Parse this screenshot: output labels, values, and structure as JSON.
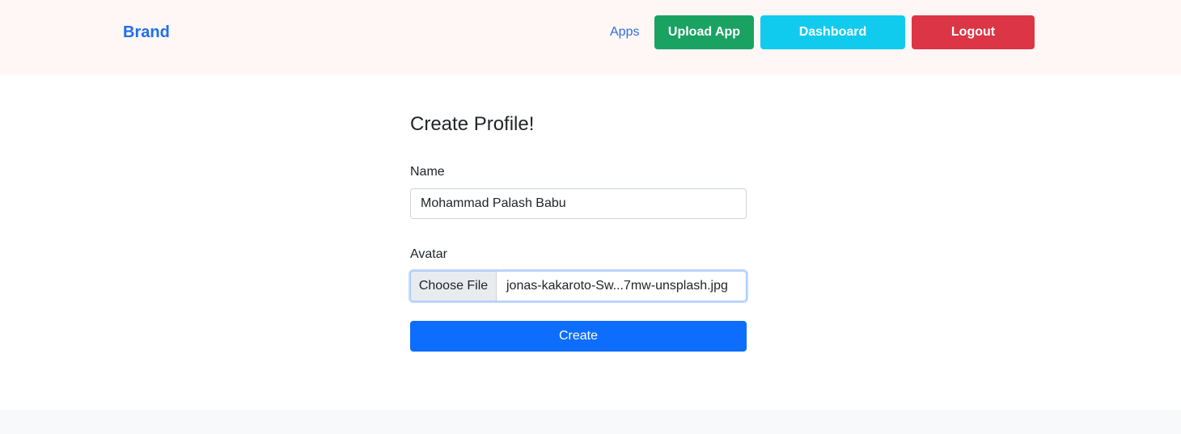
{
  "navbar": {
    "brand": "Brand",
    "links": {
      "apps": "Apps"
    },
    "buttons": {
      "upload_app": "Upload App",
      "dashboard": "Dashboard",
      "logout": "Logout"
    },
    "colors": {
      "background": "#fff6f6",
      "brand": "#1f6feb",
      "upload_app": "#1aa262",
      "dashboard": "#11cbee",
      "logout": "#dc3545"
    }
  },
  "form": {
    "title": "Create Profile!",
    "name_label": "Name",
    "name_value": "Mohammad Palash Babu",
    "avatar_label": "Avatar",
    "choose_file_label": "Choose File",
    "selected_file": "jonas-kakaroto-Sw...7mw-unsplash.jpg",
    "submit_label": "Create",
    "colors": {
      "submit": "#0d6efd",
      "focus_ring": "#c7dbfd"
    }
  }
}
